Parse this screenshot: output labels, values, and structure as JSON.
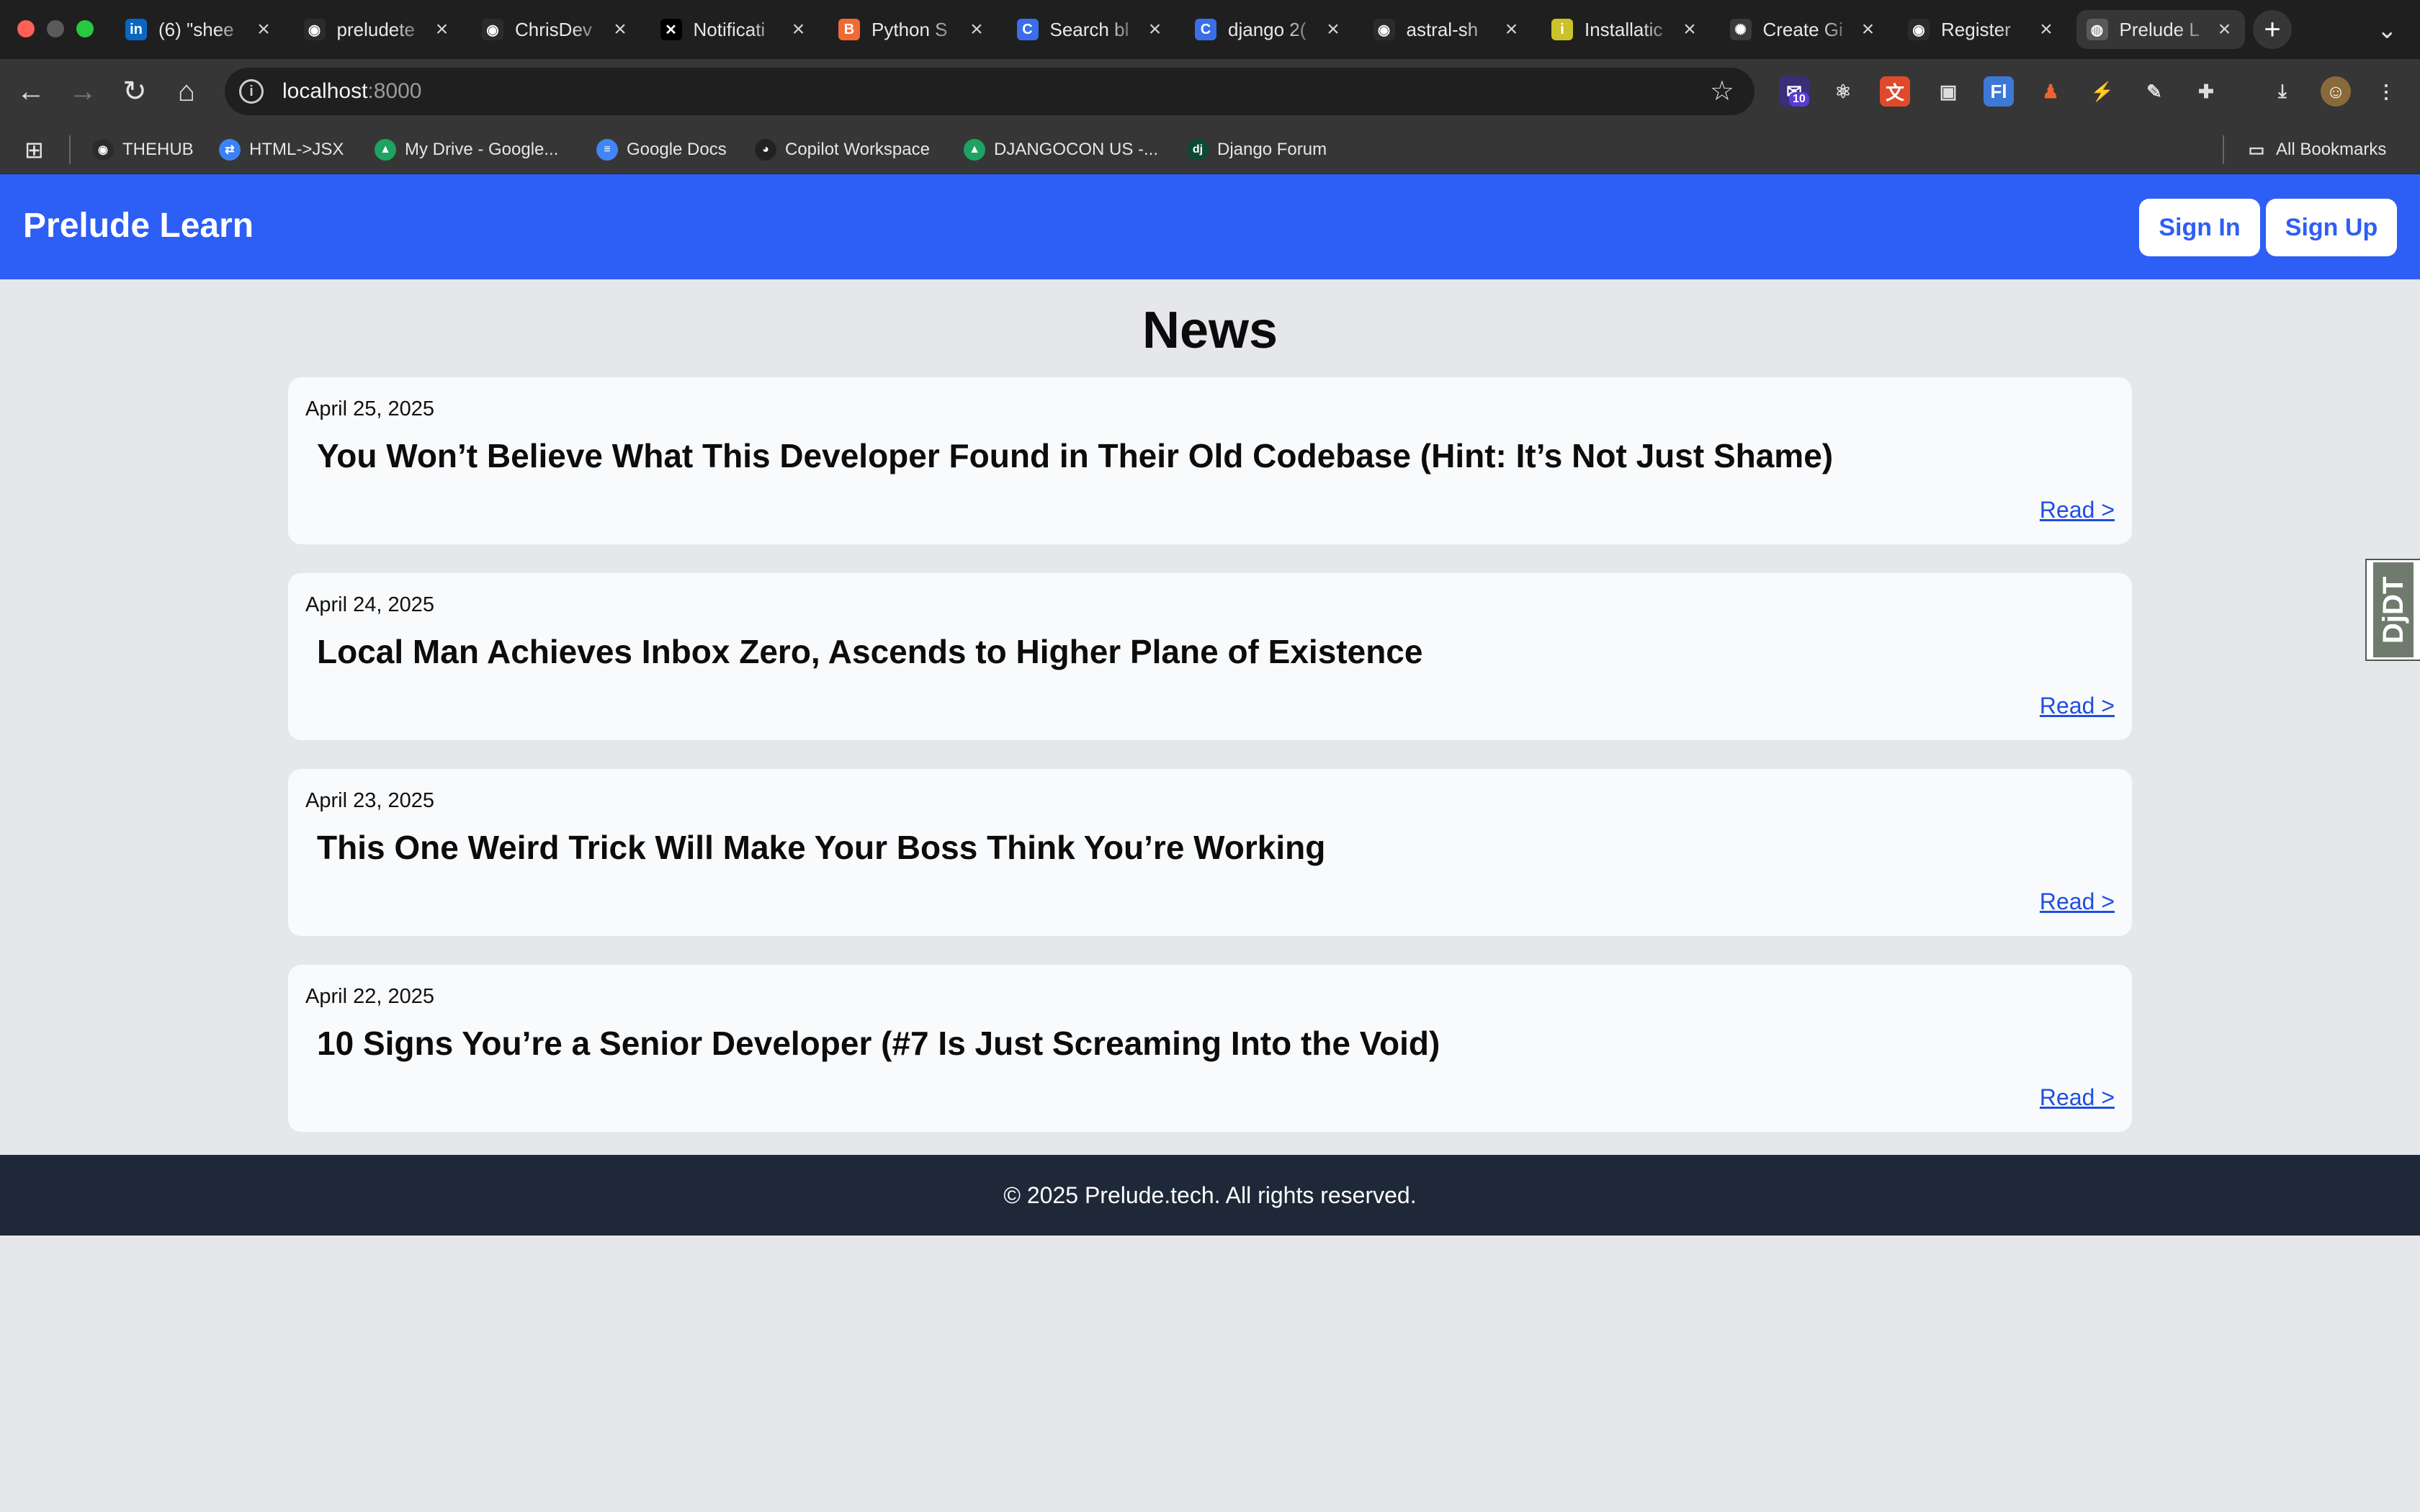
{
  "browser": {
    "tabs": [
      {
        "label": "(6) \"shee",
        "icon": "linkedin-icon",
        "color": "#0a66c2",
        "glyph": "in"
      },
      {
        "label": "preludete",
        "icon": "github-icon",
        "color": "#2b2b2b",
        "glyph": "◉"
      },
      {
        "label": "ChrisDev",
        "icon": "github-icon",
        "color": "#2b2b2b",
        "glyph": "◉"
      },
      {
        "label": "Notificati",
        "icon": "x-twitter-icon",
        "color": "#000000",
        "glyph": "✕"
      },
      {
        "label": "Python S",
        "icon": "blogger-icon",
        "color": "#f06a35",
        "glyph": "B"
      },
      {
        "label": "Search bl",
        "icon": "copilot-icon",
        "color": "#3b6ee8",
        "glyph": "C"
      },
      {
        "label": "django 2(",
        "icon": "copilot-icon",
        "color": "#3b6ee8",
        "glyph": "C"
      },
      {
        "label": "astral-sh",
        "icon": "github-icon",
        "color": "#2b2b2b",
        "glyph": "◉"
      },
      {
        "label": "Installatic",
        "icon": "docs-site-icon",
        "color": "#c9c22a",
        "glyph": "i"
      },
      {
        "label": "Create Gi",
        "icon": "openai-icon",
        "color": "#3a3a3a",
        "glyph": "✺"
      },
      {
        "label": "Register",
        "icon": "github-icon",
        "color": "#2b2b2b",
        "glyph": "◉"
      },
      {
        "label": "Prelude L",
        "icon": "globe-icon",
        "color": "#5a5a5a",
        "glyph": "◍",
        "active": true
      }
    ],
    "address": {
      "host": "localhost",
      "port": ":8000"
    },
    "bookmarks": [
      {
        "label": "THEHUB",
        "icon": "github-icon",
        "color": "#2b2b2b",
        "glyph": "◉"
      },
      {
        "label": "HTML->JSX",
        "icon": "transform-icon",
        "color": "#3b82f6",
        "glyph": "⇄"
      },
      {
        "label": "My Drive - Google...",
        "icon": "google-drive-icon",
        "color": "#1ea362",
        "glyph": "▲"
      },
      {
        "label": "Google Docs",
        "icon": "google-docs-icon",
        "color": "#4285f4",
        "glyph": "≡"
      },
      {
        "label": "Copilot Workspace",
        "icon": "copilot-workspace-icon",
        "color": "#222222",
        "glyph": "◕"
      },
      {
        "label": "DJANGOCON US -...",
        "icon": "google-drive-icon",
        "color": "#1ea362",
        "glyph": "▲"
      },
      {
        "label": "Django Forum",
        "icon": "django-icon",
        "color": "#0c4b33",
        "glyph": "dj"
      }
    ],
    "all_bookmarks": "All Bookmarks",
    "extension_badge": "10"
  },
  "site": {
    "brand": "Prelude Learn",
    "sign_in": "Sign In",
    "sign_up": "Sign Up",
    "page_title": "News",
    "news": [
      {
        "date": "April 25, 2025",
        "title": "You Won’t Believe What This Developer Found in Their Old Codebase (Hint: It’s Not Just Shame)",
        "link": "Read >"
      },
      {
        "date": "April 24, 2025",
        "title": "Local Man Achieves Inbox Zero, Ascends to Higher Plane of Existence",
        "link": "Read >"
      },
      {
        "date": "April 23, 2025",
        "title": "This One Weird Trick Will Make Your Boss Think You’re Working",
        "link": "Read >"
      },
      {
        "date": "April 22, 2025",
        "title": "10 Signs You’re a Senior Developer (#7 Is Just Screaming Into the Void)",
        "link": "Read >"
      }
    ],
    "footer": "© 2025 Prelude.tech. All rights reserved.",
    "debug_toolbar": "DjDT"
  },
  "colors": {
    "brand_blue": "#2d5ef5",
    "footer_bg": "#1f2838",
    "link": "#1f4fe0"
  }
}
